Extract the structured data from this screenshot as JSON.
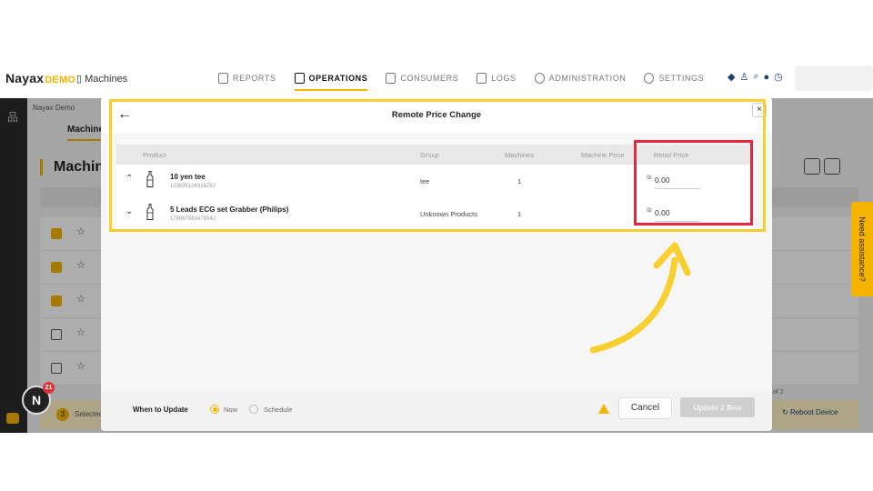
{
  "brand": {
    "name": "Nayax",
    "suffix": "DEMO"
  },
  "topbar": {
    "machines_link": "Machines",
    "nav": [
      {
        "label": "REPORTS",
        "icon": "report-icon",
        "active": false
      },
      {
        "label": "OPERATIONS",
        "icon": "operations-icon",
        "active": true
      },
      {
        "label": "CONSUMERS",
        "icon": "consumers-icon",
        "active": false
      },
      {
        "label": "LOGS",
        "icon": "logs-icon",
        "active": false
      },
      {
        "label": "ADMINISTRATION",
        "icon": "administration-icon",
        "active": false
      },
      {
        "label": "SETTINGS",
        "icon": "settings-icon",
        "active": false
      }
    ]
  },
  "background": {
    "breadcrumb": "Nayax Demo",
    "tab": "Machine",
    "title": "Machine",
    "footer_selected_count": "3",
    "footer_selected_label": "Selected",
    "reboot_label": "Reboot Device",
    "pager": "of 2"
  },
  "assist_tab": "Need assistance?",
  "badge_count": "21",
  "modal": {
    "title": "Remote Price Change",
    "columns": {
      "product": "Product",
      "group": "Group",
      "machines": "Machines",
      "machine_price": "Machine Price",
      "retail_price": "Retail Price"
    },
    "rows": [
      {
        "name": "10 yen tee",
        "sku": "123695104326782",
        "group": "tee",
        "machines": "1",
        "currency": "₪",
        "retail_price": "0.00",
        "expanded": true
      },
      {
        "name": "5 Leads ECG set Grabber (Philips)",
        "sku": "178867660479542",
        "group": "Unknown Products",
        "machines": "1",
        "currency": "₪",
        "retail_price": "0.00",
        "expanded": false
      }
    ],
    "footer": {
      "when_label": "When to Update",
      "option_now": "Now",
      "option_schedule": "Schedule",
      "selected_option": "Now",
      "cancel_label": "Cancel",
      "update_label": "Update 2 Bins"
    }
  },
  "colors": {
    "accent": "#f5b400",
    "highlight_yellow": "#f8cf2e",
    "highlight_red": "#e8263e"
  }
}
